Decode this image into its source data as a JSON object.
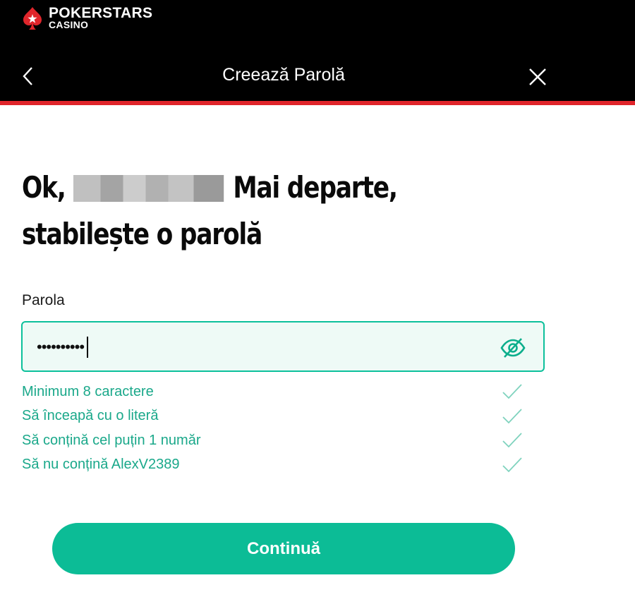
{
  "brand": {
    "name": "POKERSTARS",
    "sub": "CASINO",
    "logo_icon": "pokerstars-spade-star-icon",
    "accent_red": "#e0252b"
  },
  "header": {
    "title": "Creează Parolă",
    "back_icon": "chevron-left-icon",
    "close_icon": "close-icon"
  },
  "heading": {
    "prefix": "Ok,",
    "suffix": "Mai departe,",
    "line2": "stabilește o parolă"
  },
  "password": {
    "label": "Parola",
    "masked_value": "••••••••••",
    "toggle_icon": "eye-slash-icon",
    "border_color": "#0cc09b"
  },
  "rules": [
    {
      "text": "Minimum 8 caractere",
      "status": "met",
      "icon": "check-icon"
    },
    {
      "text": "Să înceapă cu o literă",
      "status": "met",
      "icon": "check-icon"
    },
    {
      "text": "Să conțină cel puțin 1 număr",
      "status": "met",
      "icon": "check-icon"
    },
    {
      "text": "Să nu conțină AlexV2389",
      "status": "met",
      "icon": "check-icon"
    }
  ],
  "continue_button": {
    "label": "Continuă",
    "color": "#0cbc96"
  }
}
